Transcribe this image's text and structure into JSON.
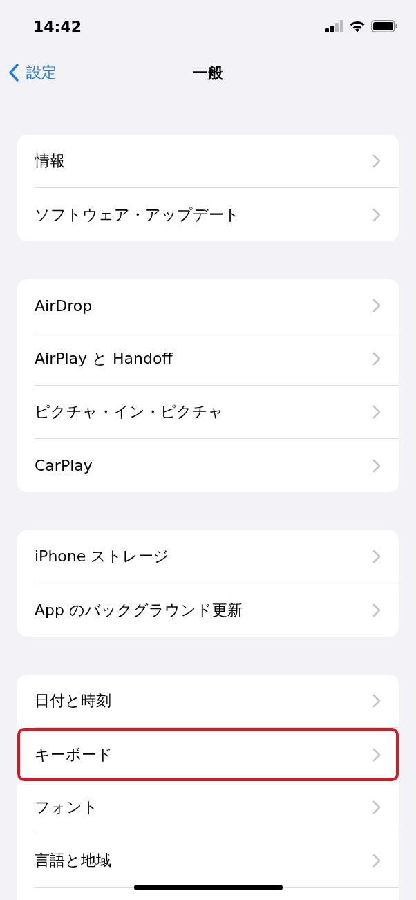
{
  "status_bar": {
    "time": "14:42"
  },
  "nav": {
    "back": "設定",
    "title": "一般"
  },
  "groups": [
    {
      "rows": [
        {
          "label": "情報",
          "highlighted": false
        },
        {
          "label": "ソフトウェア・アップデート",
          "highlighted": false
        }
      ]
    },
    {
      "rows": [
        {
          "label": "AirDrop",
          "highlighted": false
        },
        {
          "label": "AirPlay と Handoff",
          "highlighted": false
        },
        {
          "label": "ピクチャ・イン・ピクチャ",
          "highlighted": false
        },
        {
          "label": "CarPlay",
          "highlighted": false
        }
      ]
    },
    {
      "rows": [
        {
          "label": "iPhone ストレージ",
          "highlighted": false
        },
        {
          "label": "App のバックグラウンド更新",
          "highlighted": false
        }
      ]
    },
    {
      "rows": [
        {
          "label": "日付と時刻",
          "highlighted": false
        },
        {
          "label": "キーボード",
          "highlighted": true
        },
        {
          "label": "フォント",
          "highlighted": false
        },
        {
          "label": "言語と地域",
          "highlighted": false
        }
      ]
    }
  ]
}
